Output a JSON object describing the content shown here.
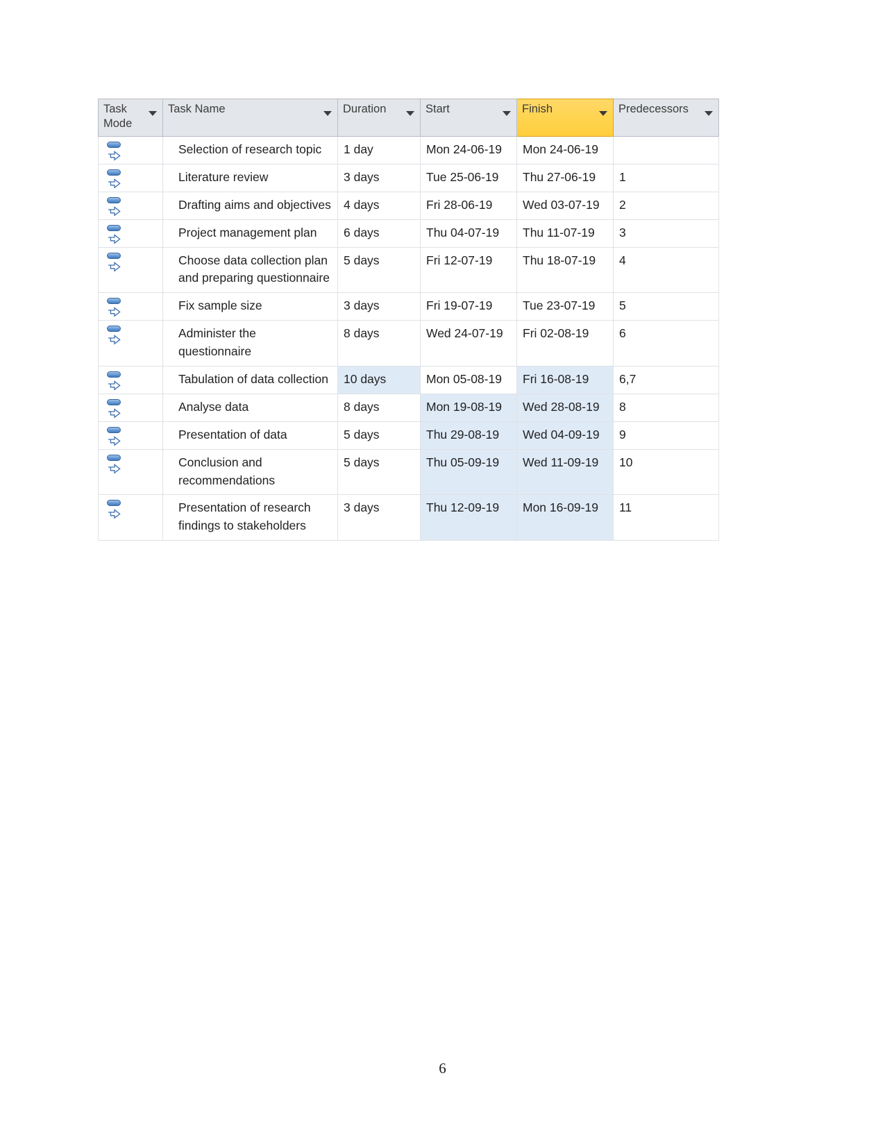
{
  "document": {
    "page_number": "6"
  },
  "table": {
    "columns": [
      {
        "key": "task_mode",
        "label": "Task Mode",
        "highlighted": false
      },
      {
        "key": "task_name",
        "label": "Task Name",
        "highlighted": false
      },
      {
        "key": "duration",
        "label": "Duration",
        "highlighted": false
      },
      {
        "key": "start",
        "label": "Start",
        "highlighted": false
      },
      {
        "key": "finish",
        "label": "Finish",
        "highlighted": true
      },
      {
        "key": "predecessors",
        "label": "Predecessors",
        "highlighted": false
      }
    ],
    "header_highlight_color": "#ffd451",
    "selection_color": "#dfeaf7",
    "task_mode_icon": "auto-scheduled-icon",
    "rows": [
      {
        "mode": "auto-scheduled-icon",
        "name": "Selection of research topic",
        "duration": "1 day",
        "start": "Mon 24-06-19",
        "finish": "Mon 24-06-19",
        "predecessors": "",
        "sel_duration": false,
        "sel_start": false,
        "sel_finish": false
      },
      {
        "mode": "auto-scheduled-icon",
        "name": "Literature review",
        "duration": "3 days",
        "start": "Tue 25-06-19",
        "finish": "Thu 27-06-19",
        "predecessors": "1",
        "sel_duration": false,
        "sel_start": false,
        "sel_finish": false
      },
      {
        "mode": "auto-scheduled-icon",
        "name": "Drafting aims and objectives",
        "duration": "4 days",
        "start": "Fri 28-06-19",
        "finish": "Wed 03-07-19",
        "predecessors": "2",
        "sel_duration": false,
        "sel_start": false,
        "sel_finish": false
      },
      {
        "mode": "auto-scheduled-icon",
        "name": "Project management plan",
        "duration": "6 days",
        "start": "Thu 04-07-19",
        "finish": "Thu 11-07-19",
        "predecessors": "3",
        "sel_duration": false,
        "sel_start": false,
        "sel_finish": false
      },
      {
        "mode": "auto-scheduled-icon",
        "name": "Choose data collection plan and preparing questionnaire",
        "duration": "5 days",
        "start": "Fri 12-07-19",
        "finish": "Thu 18-07-19",
        "predecessors": "4",
        "sel_duration": false,
        "sel_start": false,
        "sel_finish": false
      },
      {
        "mode": "auto-scheduled-icon",
        "name": "Fix sample size",
        "duration": "3 days",
        "start": "Fri 19-07-19",
        "finish": "Tue 23-07-19",
        "predecessors": "5",
        "sel_duration": false,
        "sel_start": false,
        "sel_finish": false
      },
      {
        "mode": "auto-scheduled-icon",
        "name": "Administer the questionnaire",
        "duration": "8 days",
        "start": "Wed 24-07-19",
        "finish": "Fri 02-08-19",
        "predecessors": "6",
        "sel_duration": false,
        "sel_start": false,
        "sel_finish": false
      },
      {
        "mode": "auto-scheduled-icon",
        "name": "Tabulation of data collection",
        "duration": "10 days",
        "start": "Mon 05-08-19",
        "finish": "Fri 16-08-19",
        "predecessors": "6,7",
        "sel_duration": true,
        "sel_start": false,
        "sel_finish": true
      },
      {
        "mode": "auto-scheduled-icon",
        "name": "Analyse data",
        "duration": "8 days",
        "start": "Mon 19-08-19",
        "finish": "Wed 28-08-19",
        "predecessors": "8",
        "sel_duration": false,
        "sel_start": true,
        "sel_finish": true
      },
      {
        "mode": "auto-scheduled-icon",
        "name": "Presentation of data",
        "duration": "5 days",
        "start": "Thu 29-08-19",
        "finish": "Wed 04-09-19",
        "predecessors": "9",
        "sel_duration": false,
        "sel_start": true,
        "sel_finish": true
      },
      {
        "mode": "auto-scheduled-icon",
        "name": "Conclusion and recommendations",
        "duration": "5 days",
        "start": "Thu 05-09-19",
        "finish": "Wed 11-09-19",
        "predecessors": "10",
        "sel_duration": false,
        "sel_start": true,
        "sel_finish": true
      },
      {
        "mode": "auto-scheduled-icon",
        "name": "Presentation of research findings to stakeholders",
        "duration": "3 days",
        "start": "Thu 12-09-19",
        "finish": "Mon 16-09-19",
        "predecessors": "11",
        "sel_duration": false,
        "sel_start": true,
        "sel_finish": true
      }
    ]
  }
}
